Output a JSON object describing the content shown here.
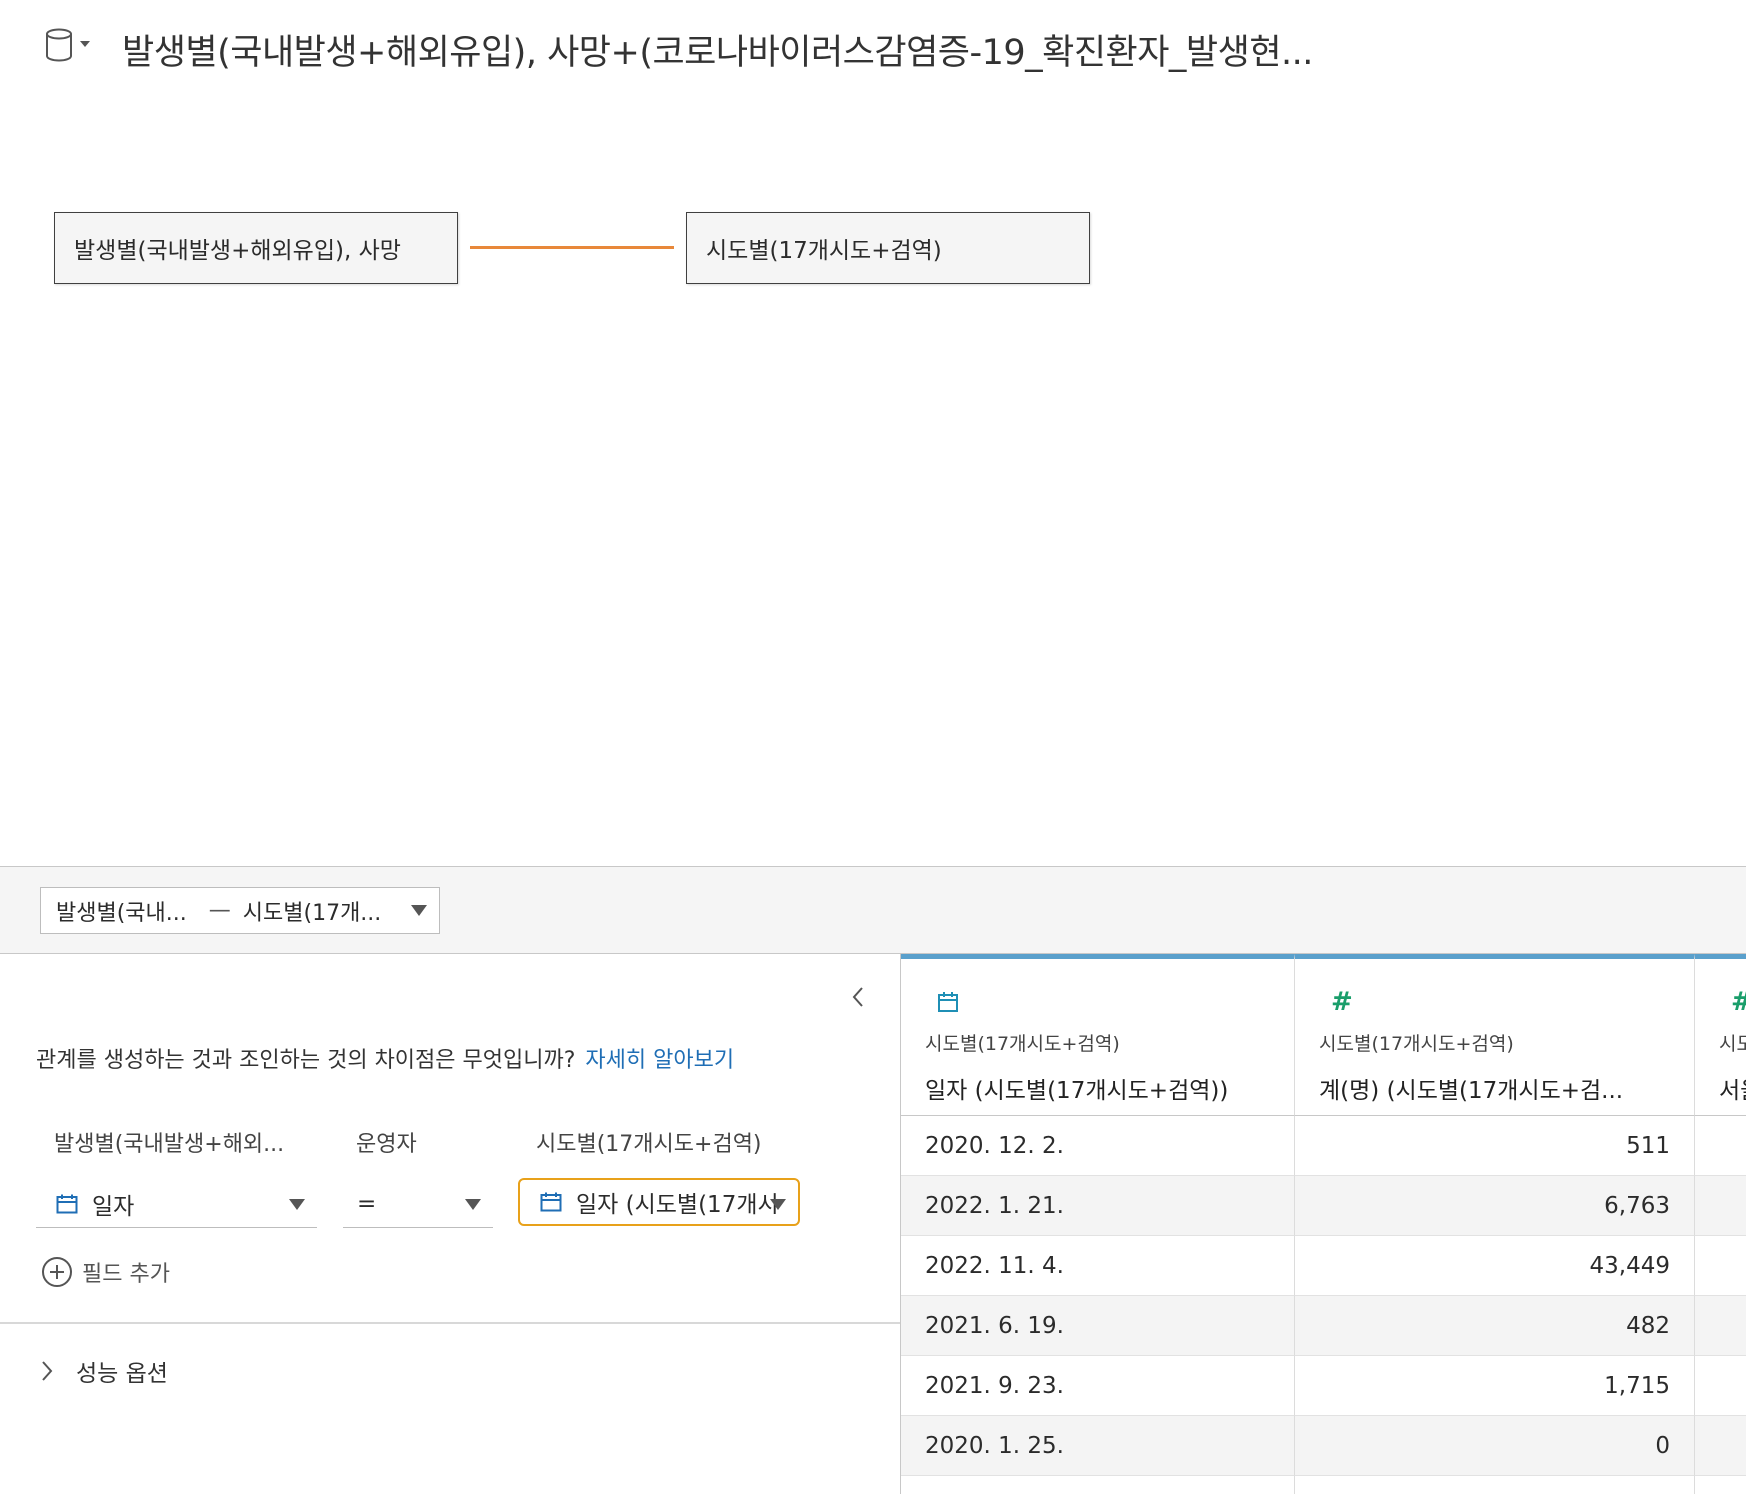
{
  "header": {
    "title": "발생별(국내발생+해외유입), 사망+(코로나바이러스감염증-19_확진환자_발생현..."
  },
  "canvas": {
    "left_table": "발생별(국내발생+해외유입), 사망",
    "right_table": "시도별(17개시도+검역)",
    "noodle_color": "#e8883a"
  },
  "relbar": {
    "left": "발생별(국내...",
    "separator": "—",
    "right": "시도별(17개..."
  },
  "panel": {
    "help_question": "관계를 생성하는 것과 조인하는 것의 차이점은 무엇입니까?",
    "help_link": "자세히 알아보기",
    "left_col_label": "발생별(국내발생+해외...",
    "operator_label": "운영자",
    "right_col_label": "시도별(17개시도+검역)",
    "left_field": "일자",
    "operator": "=",
    "right_field": "일자 (시도별(17개시",
    "add_field": "필드 추가",
    "performance": "성능 옵션"
  },
  "grid": {
    "columns": [
      {
        "icon": "calendar-icon",
        "source": "시도별(17개시도+검역)",
        "field": "일자 (시도별(17개시도+검역))"
      },
      {
        "icon": "hash-icon",
        "source": "시도별(17개시도+검역)",
        "field": "계(명) (시도별(17개시도+검..."
      },
      {
        "icon": "hash-icon",
        "source": "시도",
        "field": "서울"
      }
    ],
    "rows": [
      {
        "date": "2020. 12. 2.",
        "count": "511"
      },
      {
        "date": "2022. 1. 21.",
        "count": "6,763"
      },
      {
        "date": "2022. 11. 4.",
        "count": "43,449"
      },
      {
        "date": "2021. 6. 19.",
        "count": "482"
      },
      {
        "date": "2021. 9. 23.",
        "count": "1,715"
      },
      {
        "date": "2020. 1. 25.",
        "count": "0"
      },
      {
        "date": "",
        "count": ""
      }
    ],
    "accent_color": "#5aa0cc"
  }
}
